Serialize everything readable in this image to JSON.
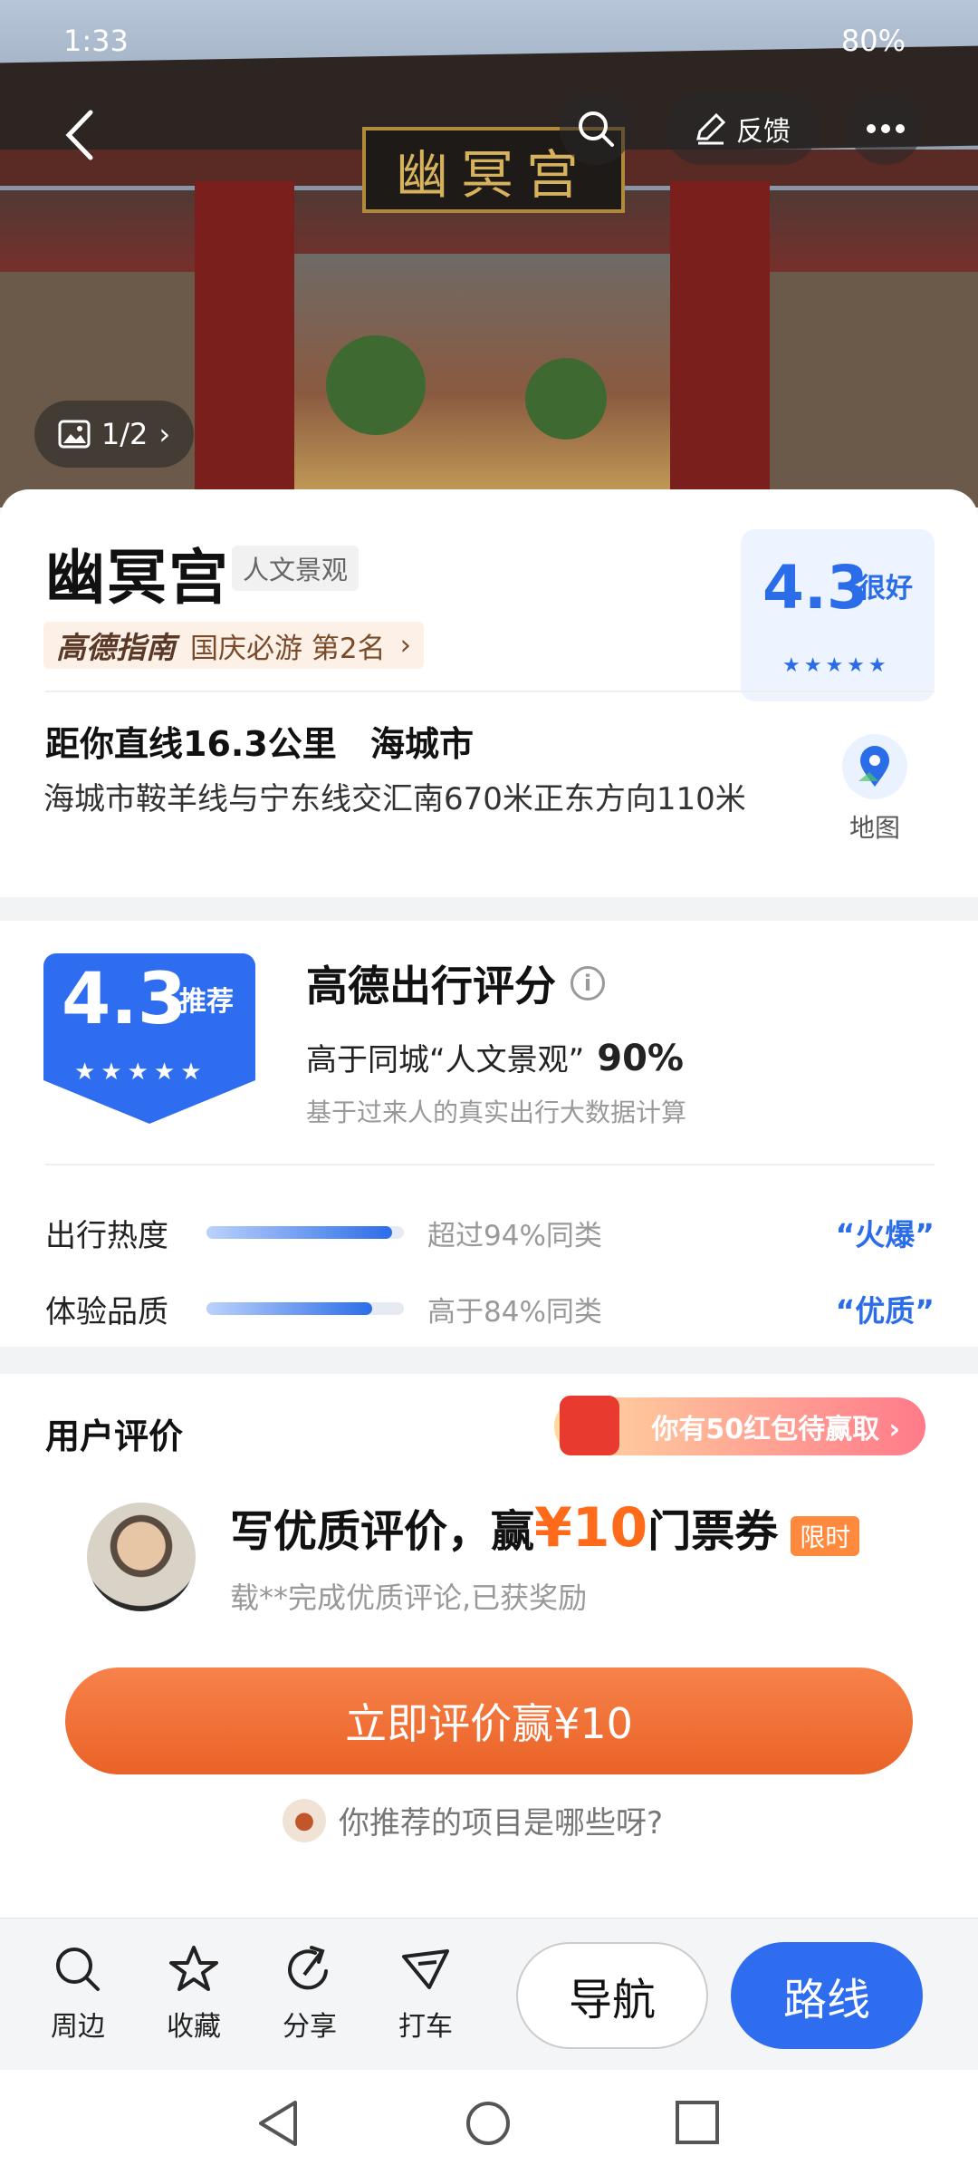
{
  "status": {
    "time": "1:33",
    "battery": "80%"
  },
  "topbar": {
    "feedback_label": "反馈"
  },
  "hero": {
    "photo_counter": "1/2",
    "plaque_text": "幽冥宫"
  },
  "poi": {
    "name": "幽冥宫",
    "category": "人文景观",
    "rank_brand": "高德指南",
    "rank_text": "国庆必游 第2名",
    "score": "4.3",
    "score_word": "很好",
    "stars": "★★★★★",
    "distance": "距你直线16.3公里",
    "city": "海城市",
    "address": "海城市鞍羊线与宁东线交汇南670米正东方向110米",
    "map_label": "地图"
  },
  "rating": {
    "score": "4.3",
    "badge_word": "推荐",
    "stars": "★★★★★",
    "title": "高德出行评分",
    "compare_prefix": "高于同城“人文景观”",
    "compare_value": "90%",
    "basis": "基于过来人的真实出行大数据计算",
    "metrics": [
      {
        "label": "出行热度",
        "text": "超过94%同类",
        "tag": "“火爆”",
        "fill": 0.94
      },
      {
        "label": "体验品质",
        "text": "高于84%同类",
        "tag": "“优质”",
        "fill": 0.84
      }
    ]
  },
  "reviews": {
    "title": "用户评价",
    "redpack": "你有50红包待赢取 ›",
    "promo_prefix": "写优质评价，赢",
    "promo_amount": "¥10",
    "promo_suffix": "门票券",
    "limit_tag": "限时",
    "promo_sub": "载**完成优质评论,已获奖励",
    "cta": "立即评价赢¥10",
    "question": "你推荐的项目是哪些呀?"
  },
  "bottom": {
    "tools": [
      {
        "label": "周边",
        "icon": "search-icon"
      },
      {
        "label": "收藏",
        "icon": "star-icon"
      },
      {
        "label": "分享",
        "icon": "share-icon"
      },
      {
        "label": "打车",
        "icon": "taxi-icon"
      }
    ],
    "nav": "导航",
    "route": "路线"
  }
}
